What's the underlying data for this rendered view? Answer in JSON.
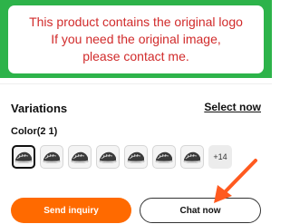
{
  "notice": {
    "line1": "This product contains the original logo",
    "line2": "If you need the original image,",
    "line3": "please contact me."
  },
  "variations": {
    "title": "Variations",
    "select_now": "Select now",
    "color_label": "Color(2 1)",
    "swatch_count_visible": 7,
    "selected_index": 0,
    "more_label": "+14"
  },
  "actions": {
    "send_inquiry": "Send inquiry",
    "chat_now": "Chat now"
  },
  "colors": {
    "banner_green": "#2db34a",
    "notice_red": "#d12b2b",
    "primary_orange": "#ff6a00",
    "arrow_orange": "#ff5a1f"
  },
  "icons": {
    "swatch_image": "shoe-thumbnail-icon",
    "annotation": "pointer-arrow-icon"
  }
}
